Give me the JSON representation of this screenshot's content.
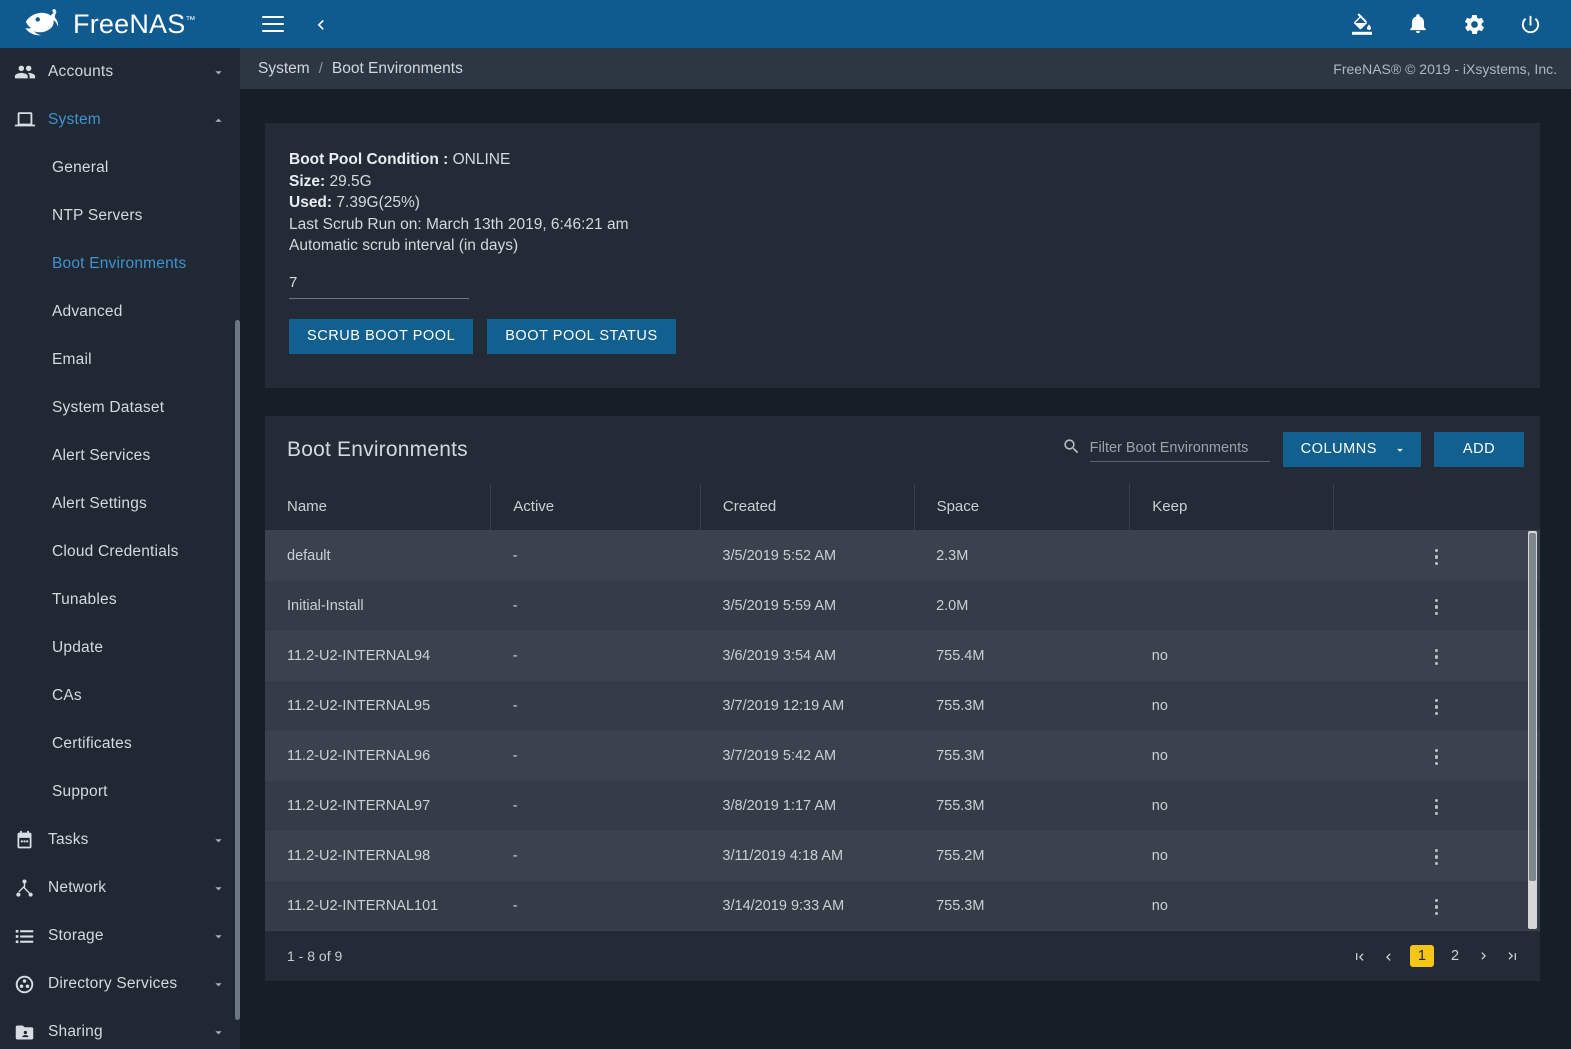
{
  "brand": {
    "name": "FreeNAS",
    "trademark": "™",
    "logo_icon": "freenas-fish-logo"
  },
  "topbar": {
    "menu_icon": "hamburger-menu-icon",
    "back_icon": "chevron-left-icon",
    "icons": [
      {
        "name": "format-color-fill-icon"
      },
      {
        "name": "notifications-bell-icon"
      },
      {
        "name": "settings-gear-icon"
      },
      {
        "name": "power-icon"
      }
    ],
    "accent_color": "#0f5b8f"
  },
  "breadcrumb": {
    "items": [
      "System",
      "Boot Environments"
    ],
    "separator": "/",
    "copyright": "FreeNAS® © 2019 - iXsystems, Inc."
  },
  "sidebar": {
    "groups": [
      {
        "label": "Accounts",
        "icon": "accounts-people-icon",
        "expanded": false,
        "active": false,
        "children": []
      },
      {
        "label": "System",
        "icon": "system-computer-icon",
        "expanded": true,
        "active": true,
        "children": [
          {
            "label": "General",
            "active": false
          },
          {
            "label": "NTP Servers",
            "active": false
          },
          {
            "label": "Boot Environments",
            "active": true
          },
          {
            "label": "Advanced",
            "active": false
          },
          {
            "label": "Email",
            "active": false
          },
          {
            "label": "System Dataset",
            "active": false
          },
          {
            "label": "Alert Services",
            "active": false
          },
          {
            "label": "Alert Settings",
            "active": false
          },
          {
            "label": "Cloud Credentials",
            "active": false
          },
          {
            "label": "Tunables",
            "active": false
          },
          {
            "label": "Update",
            "active": false
          },
          {
            "label": "CAs",
            "active": false
          },
          {
            "label": "Certificates",
            "active": false
          },
          {
            "label": "Support",
            "active": false
          }
        ]
      },
      {
        "label": "Tasks",
        "icon": "tasks-calendar-icon",
        "expanded": false,
        "active": false,
        "children": []
      },
      {
        "label": "Network",
        "icon": "network-sitemap-icon",
        "expanded": false,
        "active": false,
        "children": []
      },
      {
        "label": "Storage",
        "icon": "storage-list-icon",
        "expanded": false,
        "active": false,
        "children": []
      },
      {
        "label": "Directory Services",
        "icon": "directory-services-icon",
        "expanded": false,
        "active": false,
        "children": []
      },
      {
        "label": "Sharing",
        "icon": "sharing-folder-icon",
        "expanded": false,
        "active": false,
        "children": []
      }
    ]
  },
  "pool_card": {
    "condition_label": "Boot Pool Condition :",
    "condition_value": "ONLINE",
    "size_label": "Size:",
    "size_value": "29.5G",
    "used_label": "Used:",
    "used_value": "7.39G(25%)",
    "last_scrub": "Last Scrub Run on: March 13th 2019, 6:46:21 am",
    "interval_label": "Automatic scrub interval (in days)",
    "interval_value": "7",
    "interval_placeholder": "",
    "scrub_button": "SCRUB BOOT POOL",
    "status_button": "BOOT POOL STATUS"
  },
  "table": {
    "title": "Boot Environments",
    "search_placeholder": "Filter Boot Environments",
    "search_value": "",
    "search_icon": "search-icon",
    "columns_button": "COLUMNS",
    "columns_caret_icon": "chevron-down-icon",
    "add_button": "ADD",
    "headers": [
      "Name",
      "Active",
      "Created",
      "Space",
      "Keep",
      ""
    ],
    "rows": [
      {
        "name": "default",
        "active": "-",
        "created": "3/5/2019 5:52 AM",
        "space": "2.3M",
        "keep": ""
      },
      {
        "name": "Initial-Install",
        "active": "-",
        "created": "3/5/2019 5:59 AM",
        "space": "2.0M",
        "keep": ""
      },
      {
        "name": "11.2-U2-INTERNAL94",
        "active": "-",
        "created": "3/6/2019 3:54 AM",
        "space": "755.4M",
        "keep": "no"
      },
      {
        "name": "11.2-U2-INTERNAL95",
        "active": "-",
        "created": "3/7/2019 12:19 AM",
        "space": "755.3M",
        "keep": "no"
      },
      {
        "name": "11.2-U2-INTERNAL96",
        "active": "-",
        "created": "3/7/2019 5:42 AM",
        "space": "755.3M",
        "keep": "no"
      },
      {
        "name": "11.2-U2-INTERNAL97",
        "active": "-",
        "created": "3/8/2019 1:17 AM",
        "space": "755.3M",
        "keep": "no"
      },
      {
        "name": "11.2-U2-INTERNAL98",
        "active": "-",
        "created": "3/11/2019 4:18 AM",
        "space": "755.2M",
        "keep": "no"
      },
      {
        "name": "11.2-U2-INTERNAL101",
        "active": "-",
        "created": "3/14/2019 9:33 AM",
        "space": "755.3M",
        "keep": "no"
      }
    ],
    "row_menu_icon": "kebab-menu-icon"
  },
  "pagination": {
    "range_label": "1 - 8 of 9",
    "first_icon": "first-page-icon",
    "prev_icon": "previous-page-icon",
    "next_icon": "next-page-icon",
    "last_icon": "last-page-icon",
    "pages": [
      "1",
      "2"
    ],
    "current_page": "1",
    "current_page_color": "#f5c518"
  }
}
